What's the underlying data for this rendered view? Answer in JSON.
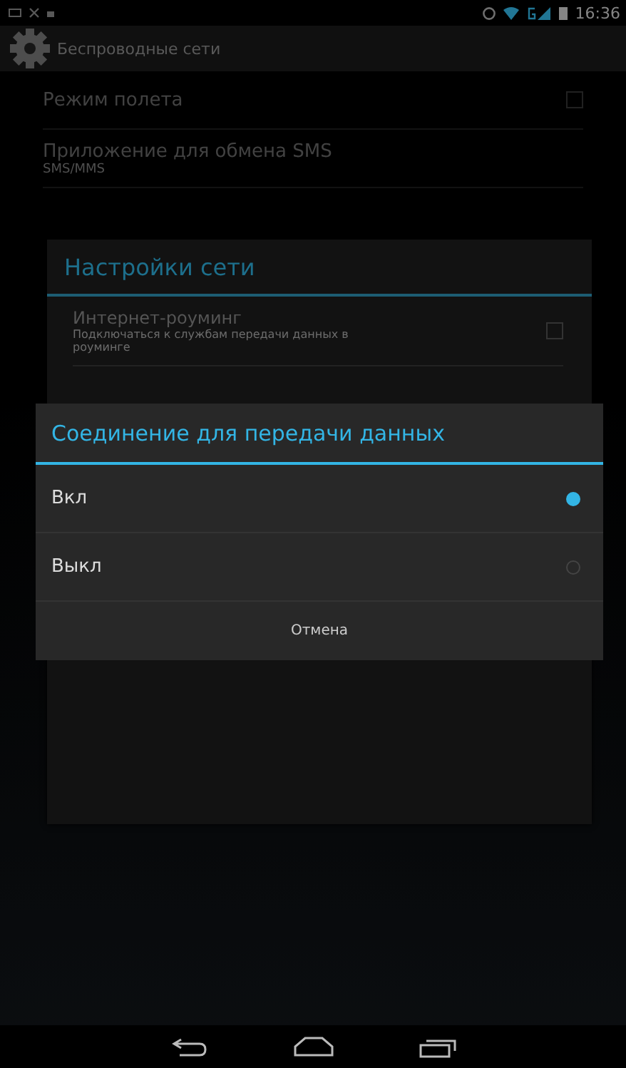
{
  "status_bar": {
    "time": "16:36"
  },
  "action_bar": {
    "title": "Беспроводные сети"
  },
  "settings": [
    {
      "title": "Режим полета",
      "kind": "checkbox",
      "checked": false
    },
    {
      "title": "Приложение для обмена SMS",
      "summary": "SMS/MMS",
      "kind": "plain"
    }
  ],
  "network_dialog": {
    "title": "Настройки сети",
    "items": [
      {
        "title": "Интернет-роуминг",
        "summary": "Подключаться к службам передачи данных в роуминге",
        "checked": false
      }
    ]
  },
  "data_dialog": {
    "title": "Соединение для передачи данных",
    "options": [
      {
        "label": "Вкл",
        "selected": true
      },
      {
        "label": "Выкл",
        "selected": false
      }
    ],
    "cancel": "Отмена"
  }
}
